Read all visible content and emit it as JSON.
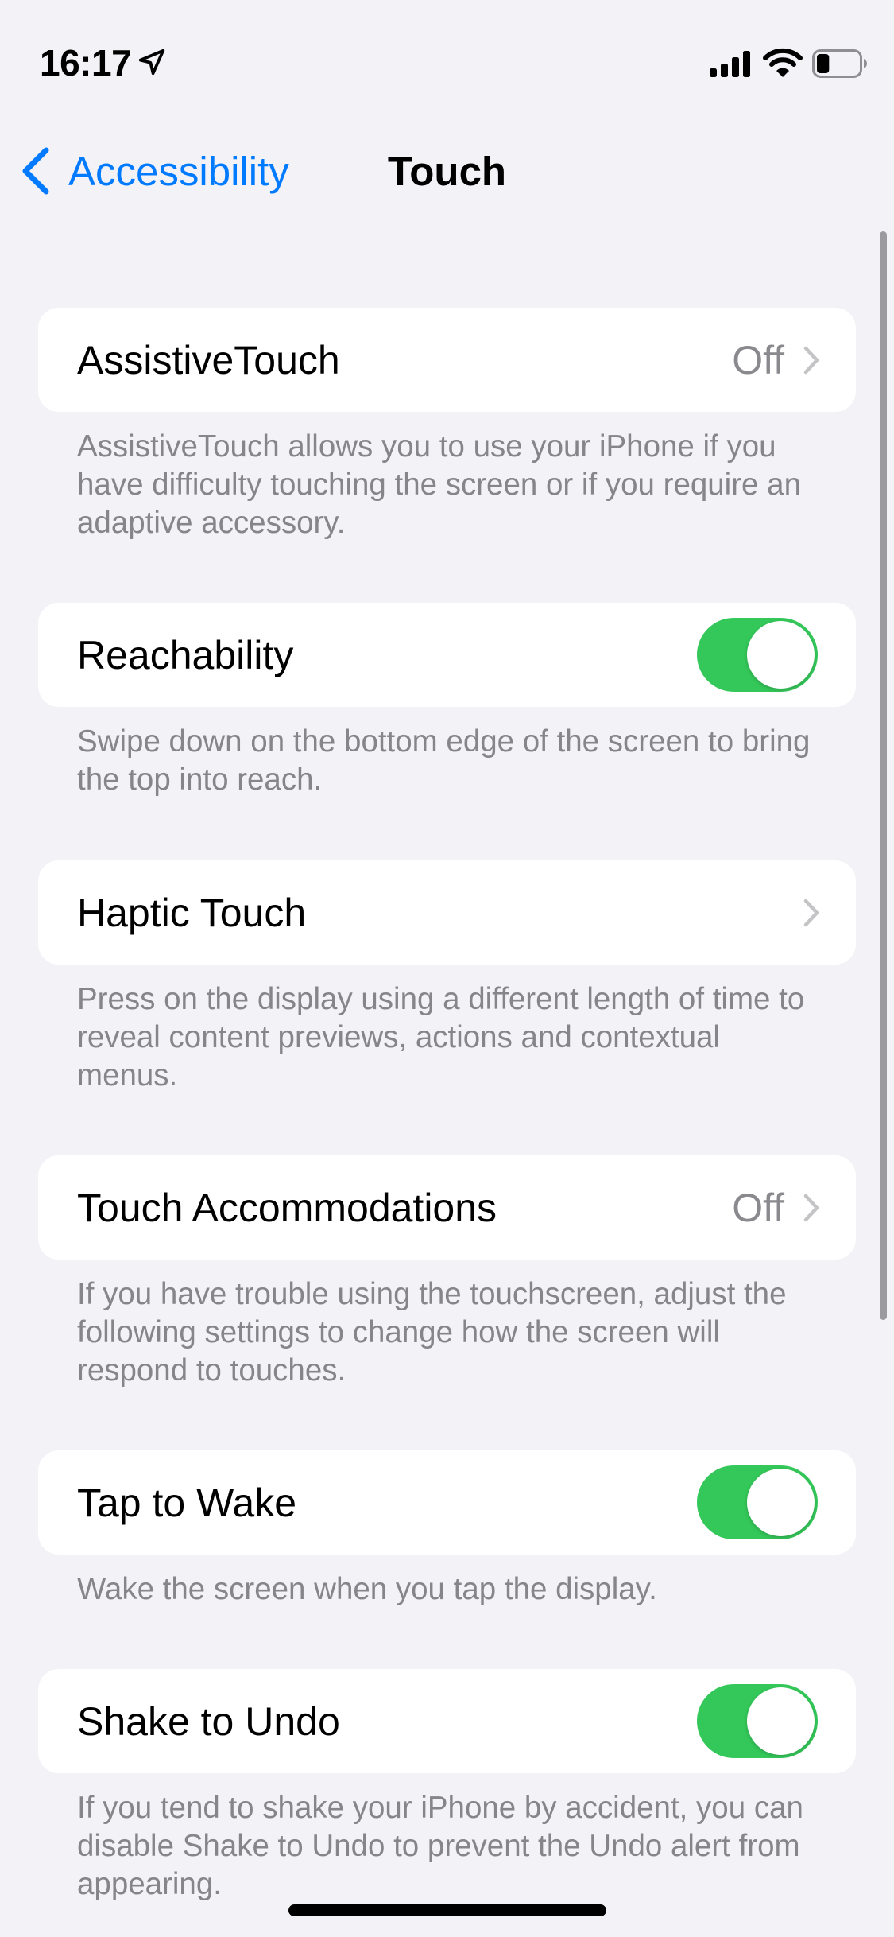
{
  "status_bar": {
    "time": "16:17",
    "location_icon": "location-arrow-icon",
    "signal_icon": "cellular-signal-icon",
    "wifi_icon": "wifi-icon",
    "battery_icon": "battery-icon",
    "battery_level_percent": 30
  },
  "nav": {
    "back_label": "Accessibility",
    "back_icon": "chevron-left-icon",
    "title": "Touch"
  },
  "colors": {
    "accent": "#007AFF",
    "toggle_on": "#34C759",
    "background": "#F2F2F7",
    "secondary_text": "#85858A"
  },
  "settings": [
    {
      "label": "AssistiveTouch",
      "type": "disclosure",
      "value": "Off",
      "footer": "AssistiveTouch allows you to use your iPhone if you have difficulty touching the screen or if you require an adaptive accessory."
    },
    {
      "label": "Reachability",
      "type": "toggle",
      "on": true,
      "footer": "Swipe down on the bottom edge of the screen to bring the top into reach."
    },
    {
      "label": "Haptic Touch",
      "type": "disclosure",
      "value": "",
      "footer": "Press on the display using a different length of time to reveal content previews, actions and contextual menus."
    },
    {
      "label": "Touch Accommodations",
      "type": "disclosure",
      "value": "Off",
      "footer": "If you have trouble using the touchscreen, adjust the following settings to change how the screen will respond to touches."
    },
    {
      "label": "Tap to Wake",
      "type": "toggle",
      "on": true,
      "footer": "Wake the screen when you tap the display."
    },
    {
      "label": "Shake to Undo",
      "type": "toggle",
      "on": true,
      "footer": "If you tend to shake your iPhone by accident, you can disable Shake to Undo to prevent the Undo alert from appearing."
    }
  ]
}
